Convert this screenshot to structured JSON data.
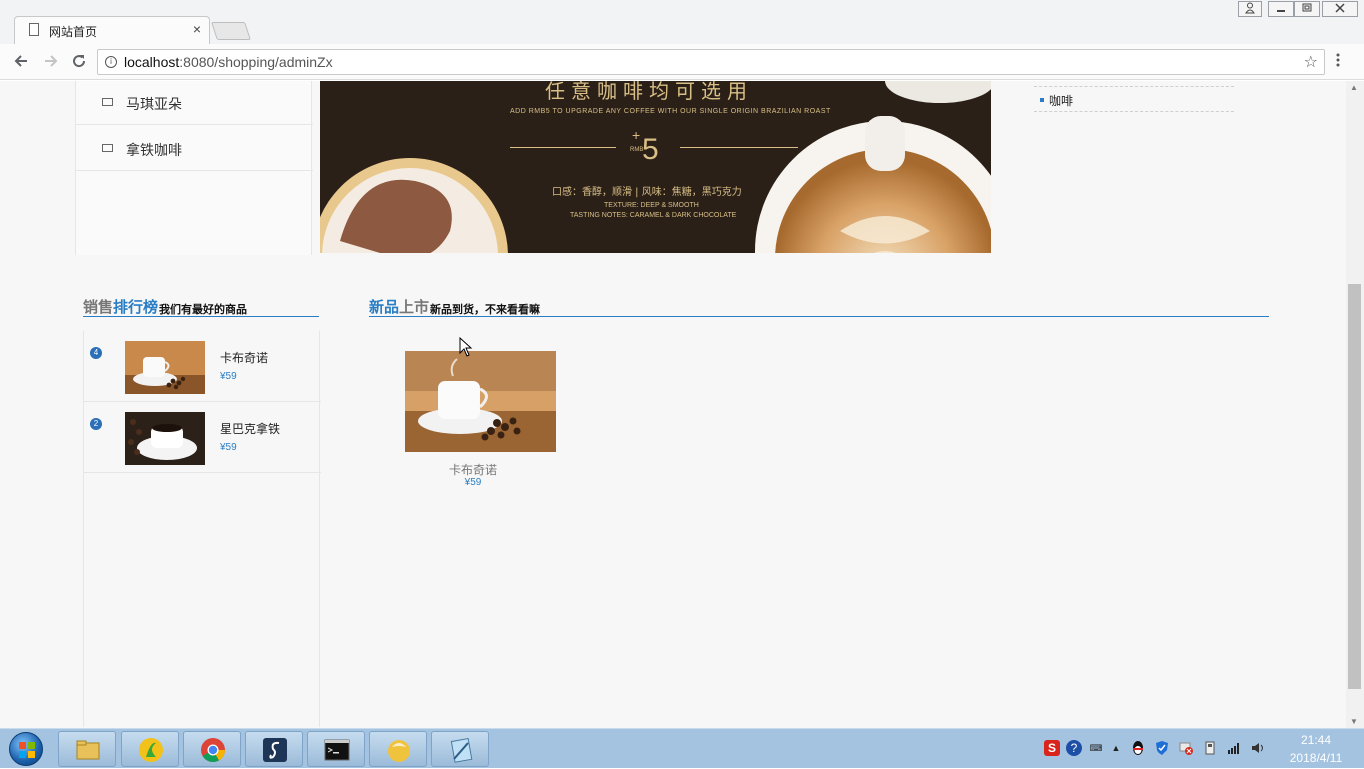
{
  "browser": {
    "tab_title": "网站首页",
    "tab_close": "×",
    "url_host": "localhost",
    "url_rest": ":8080/shopping/adminZx"
  },
  "menu": {
    "items": [
      {
        "label": "马琪亚朵"
      },
      {
        "label": "拿铁咖啡"
      }
    ]
  },
  "banner": {
    "title": "任意咖啡均可选用",
    "subtitle": "ADD RMB5 TO UPGRADE ANY COFFEE WITH OUR SINGLE ORIGIN BRAZILIAN ROAST",
    "plus": "+",
    "price": "5",
    "rmb": "RMB",
    "taste": "口感：香醇，顺滑 | 风味：焦糖，黑巧克力",
    "texture": "TEXTURE: DEEP & SMOOTH",
    "tasting_notes": "TASTING NOTES: CARAMEL & DARK CHOCOLATE"
  },
  "news": {
    "items": [
      {
        "label": "咖啡"
      }
    ]
  },
  "ranking": {
    "title_a": "销售",
    "title_b": "排行榜",
    "subtitle": "我们有最好的商品",
    "items": [
      {
        "rank": "4",
        "name": "卡布奇诺",
        "price": "¥59"
      },
      {
        "rank": "2",
        "name": "星巴克拿铁",
        "price": "¥59"
      }
    ]
  },
  "new_arrivals": {
    "title_a": "新品",
    "title_b": "上市",
    "subtitle": "新品到货，不来看看嘛",
    "product": {
      "name": "卡布奇诺",
      "price": "¥59"
    }
  },
  "taskbar": {
    "time": "21:44",
    "date": "2018/4/11"
  },
  "colors": {
    "accent": "#2a7dc4",
    "taskbar": "#a3c3e0"
  }
}
